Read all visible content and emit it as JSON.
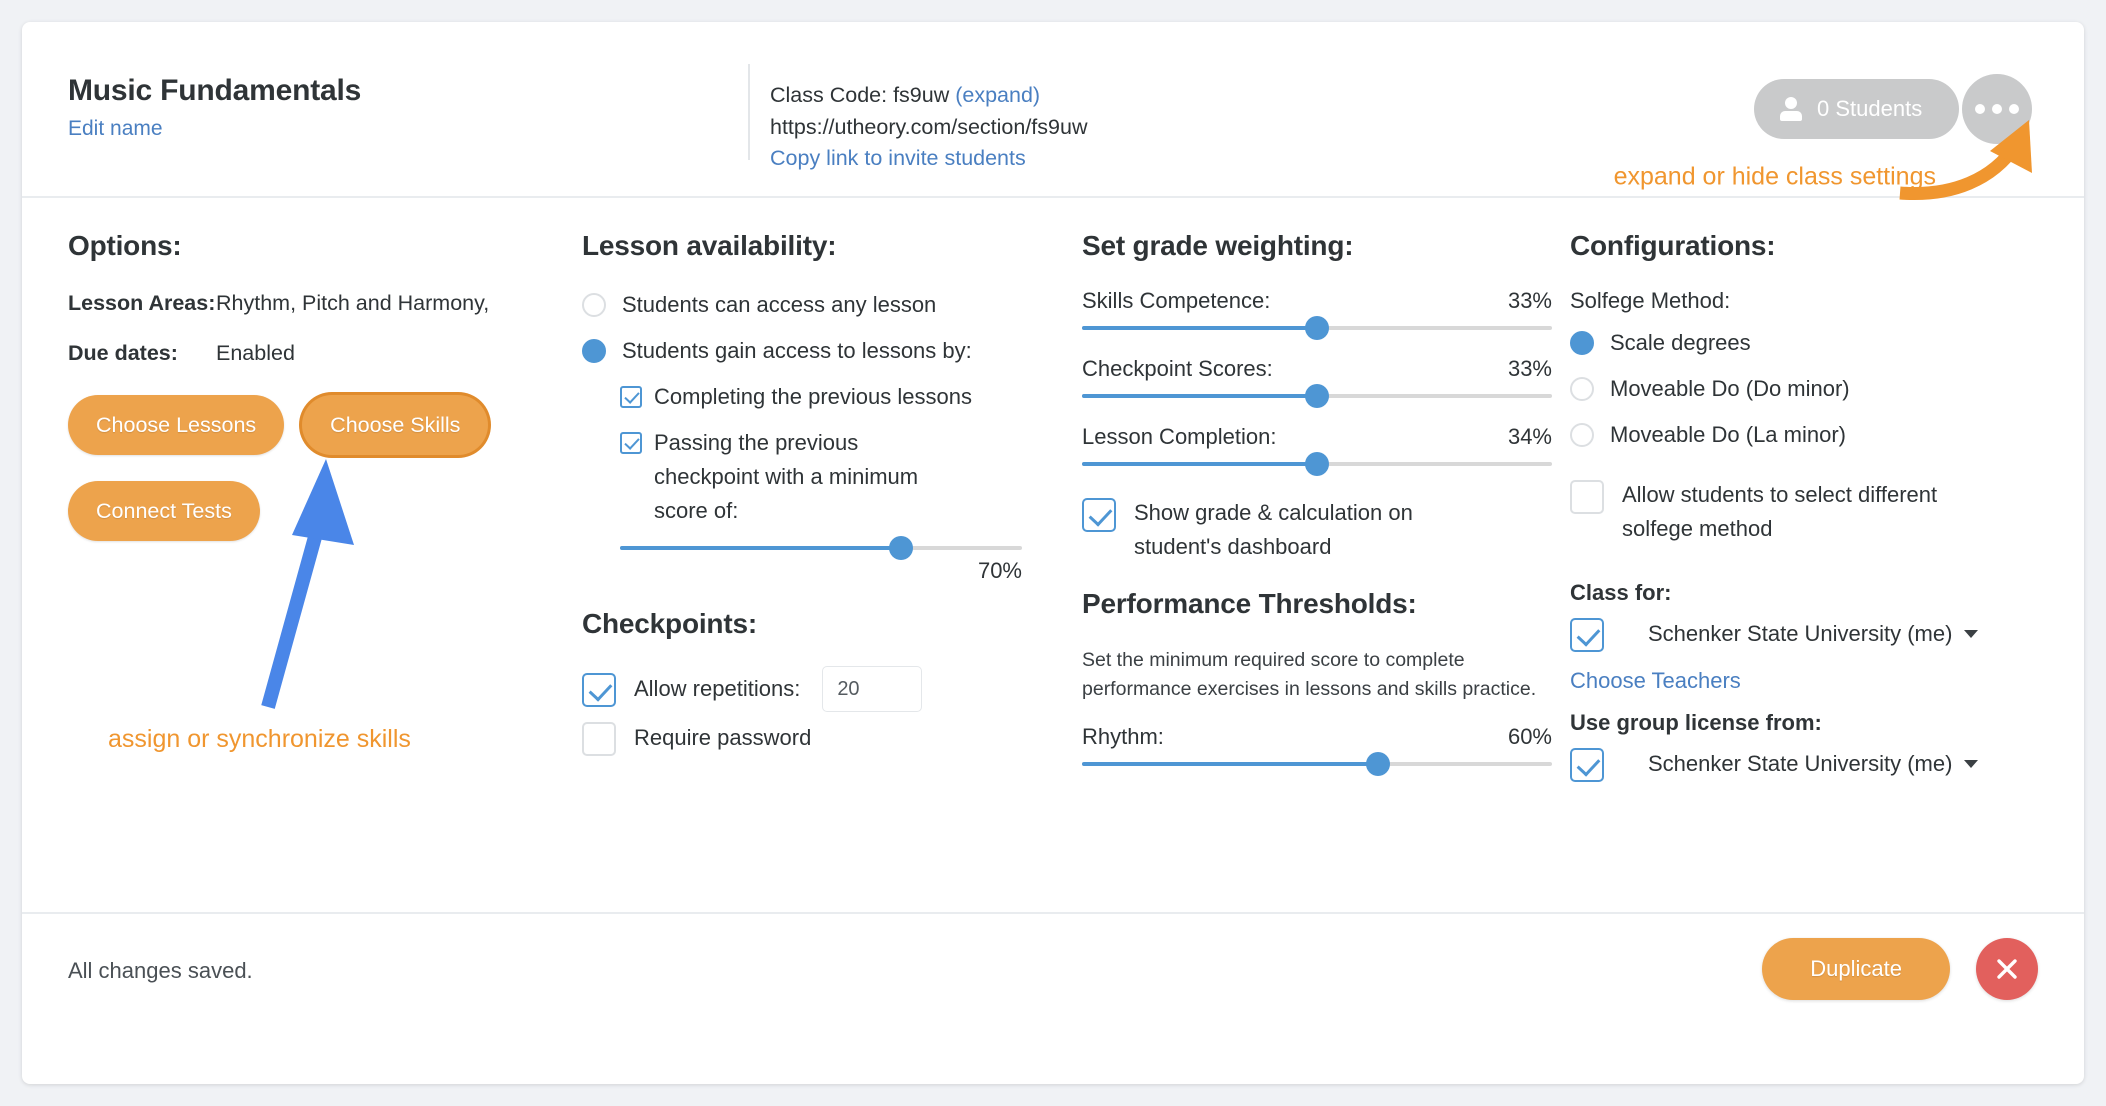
{
  "header": {
    "class_title": "Music Fundamentals",
    "edit_name": "Edit name",
    "class_code_prefix": "Class Code: fs9uw ",
    "class_code_expand": "(expand)",
    "class_url": "https://utheory.com/section/fs9uw",
    "copy_link": "Copy link to invite students",
    "students_count": "0 Students",
    "annotation": "expand or hide class settings"
  },
  "options": {
    "heading": "Options:",
    "rows": [
      {
        "key": "Lesson Areas:",
        "value": "Rhythm, Pitch and Harmony,"
      },
      {
        "key": "Due dates:",
        "value": "Enabled"
      }
    ],
    "choose_lessons": "Choose Lessons",
    "choose_skills": "Choose Skills",
    "connect_tests": "Connect Tests",
    "annotation": "assign or synchronize skills"
  },
  "lesson_availability": {
    "heading": "Lesson availability:",
    "radio_any": "Students can access any lesson",
    "radio_gain": "Students gain access to lessons by:",
    "cb_completing": "Completing the previous lessons",
    "cb_passing": "Passing the previous checkpoint with a minimum score of:",
    "min_score_pct": "70%",
    "min_score_value": 70
  },
  "checkpoints": {
    "heading": "Checkpoints:",
    "allow_repetitions": "Allow repetitions:",
    "repetitions_value": "20",
    "require_password": "Require password"
  },
  "grade_weighting": {
    "heading": "Set grade weighting:",
    "sliders": [
      {
        "label": "Skills Competence:",
        "pct": "33%",
        "value": 50
      },
      {
        "label": "Checkpoint Scores:",
        "pct": "33%",
        "value": 50
      },
      {
        "label": "Lesson Completion:",
        "pct": "34%",
        "value": 50
      }
    ],
    "show_grade": "Show grade & calculation on student's dashboard"
  },
  "performance_thresholds": {
    "heading": "Performance Thresholds:",
    "description": "Set the minimum required score to complete performance exercises in lessons and skills practice.",
    "rhythm_label": "Rhythm:",
    "rhythm_pct": "60%",
    "rhythm_value": 63
  },
  "configurations": {
    "heading": "Configurations:",
    "solfege_label": "Solfege Method:",
    "solfege_options": [
      {
        "label": "Scale degrees",
        "selected": true
      },
      {
        "label": "Moveable Do (Do minor)",
        "selected": false
      },
      {
        "label": "Moveable Do (La minor)",
        "selected": false
      }
    ],
    "allow_different_solfege": "Allow students to select different solfege method",
    "class_for_label": "Class for:",
    "class_for_value": "Schenker State University (me)",
    "choose_teachers": "Choose Teachers",
    "group_license_label": "Use group license from:",
    "group_license_value": "Schenker State University (me)"
  },
  "footer": {
    "saved_text": "All changes saved.",
    "duplicate": "Duplicate"
  },
  "colors": {
    "orange": "#eda34c",
    "annotation_orange": "#f0962f",
    "blue": "#4e96d4",
    "link_blue": "#4a7fc1",
    "red": "#e2605d",
    "gray_pill": "#c9cacb"
  }
}
